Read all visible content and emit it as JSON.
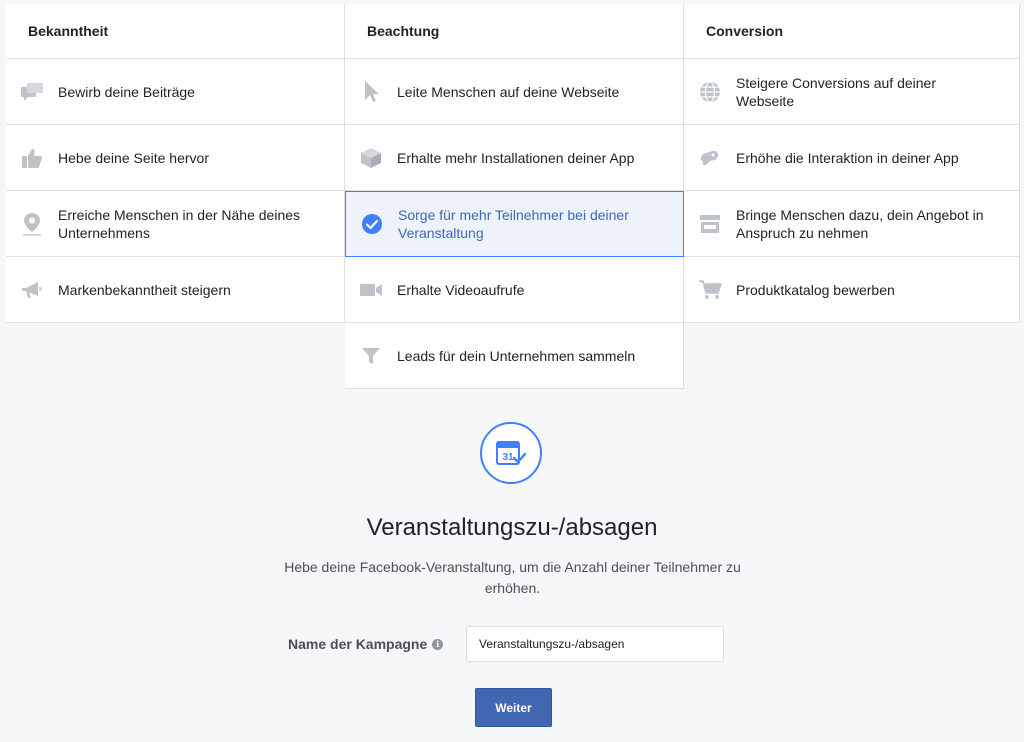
{
  "columns": [
    {
      "heading": "Bekanntheit"
    },
    {
      "heading": "Beachtung"
    },
    {
      "heading": "Conversion"
    }
  ],
  "objectives": {
    "col0": [
      {
        "label": "Bewirb deine Beiträge",
        "icon": "speech-bubbles-icon"
      },
      {
        "label": "Hebe deine Seite hervor",
        "icon": "thumbs-up-icon"
      },
      {
        "label": "Erreiche Menschen in der Nähe deines Unternehmens",
        "icon": "map-pin-icon"
      },
      {
        "label": "Markenbekanntheit steigern",
        "icon": "megaphone-icon"
      }
    ],
    "col1": [
      {
        "label": "Leite Menschen auf deine Webseite",
        "icon": "cursor-icon"
      },
      {
        "label": "Erhalte mehr Installationen deiner App",
        "icon": "box-icon"
      },
      {
        "label": "Sorge für mehr Teilnehmer bei deiner Veranstaltung",
        "icon": "check-circle-icon",
        "selected": true
      },
      {
        "label": "Erhalte Videoaufrufe",
        "icon": "video-camera-icon"
      },
      {
        "label": "Leads für dein Unternehmen sammeln",
        "icon": "funnel-icon"
      }
    ],
    "col2": [
      {
        "label": "Steigere Conversions auf deiner Webseite",
        "icon": "globe-icon"
      },
      {
        "label": "Erhöhe die Interaktion in deiner App",
        "icon": "gamepad-icon"
      },
      {
        "label": "Bringe Menschen dazu, dein Angebot in Anspruch zu nehmen",
        "icon": "storefront-icon"
      },
      {
        "label": "Produktkatalog bewerben",
        "icon": "shopping-cart-icon"
      }
    ]
  },
  "detail": {
    "icon": "calendar-check-icon",
    "calendar_day": "31",
    "title": "Veranstaltungszu-/absagen",
    "description": "Hebe deine Facebook-Veranstaltung, um die Anzahl deiner Teilnehmer zu erhöhen.",
    "campaign_label": "Name der Kampagne",
    "campaign_value": "Veranstaltungszu-/absagen",
    "submit_label": "Weiter"
  },
  "colors": {
    "accent": "#4267b2",
    "selected_border": "#4080ff",
    "selected_bg": "#edf2fb",
    "icon_gray": "#bec3c9"
  }
}
